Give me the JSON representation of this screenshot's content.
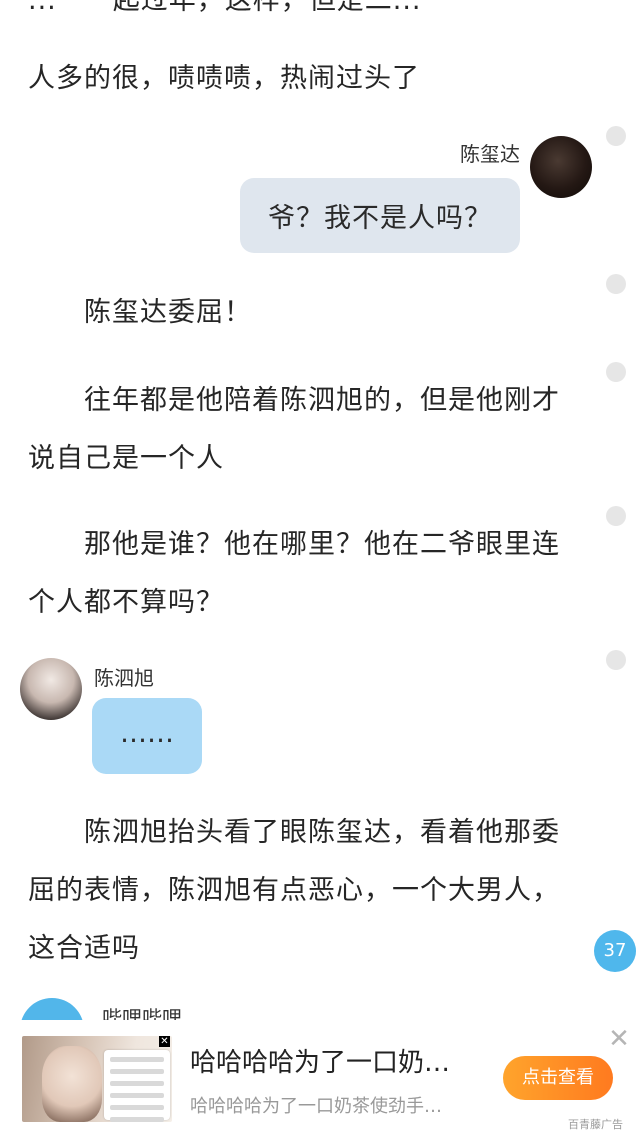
{
  "story": {
    "cut_line": "...一一起过年，这样，但是二...",
    "top_line": "人多的很，啧啧啧，热闹过头了",
    "para1": "陈玺达委屈！",
    "para2": "往年都是他陪着陈泗旭的，但是他刚才说自己是一个人",
    "para3": "那他是谁？他在哪里？他在二爷眼里连个人都不算吗？",
    "para4": "陈泗旭抬头看了眼陈玺达，看着他那委屈的表情，陈泗旭有点恶心，一个大男人，这合适吗"
  },
  "chat": {
    "right_name": "陈玺达",
    "right_text": "爷？我不是人吗？",
    "left_name": "陈泗旭",
    "left_text": "……",
    "next_name": "哔哩哔哩"
  },
  "comment_badge": "37",
  "ad": {
    "title": "哈哈哈哈为了一口奶…",
    "subtitle": "哈哈哈哈为了一口奶茶使劲手…",
    "button": "点击查看",
    "brand": "百青藤广告",
    "close": "✕",
    "thumb_close": "✕"
  }
}
